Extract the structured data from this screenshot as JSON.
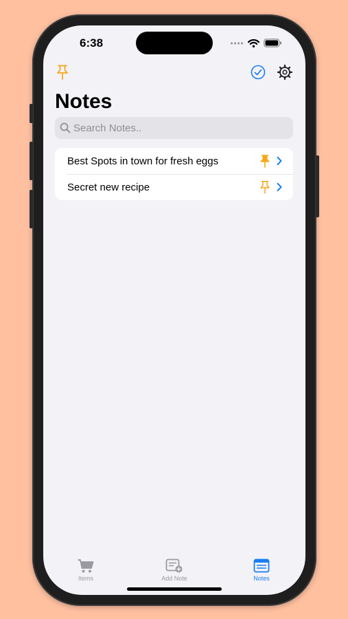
{
  "status_bar": {
    "time": "6:38"
  },
  "toolbar": {
    "pin_filter_icon": "pin-icon",
    "select_icon": "checkmark-circle-icon",
    "settings_icon": "gear-icon"
  },
  "page": {
    "title": "Notes"
  },
  "search": {
    "placeholder": "Search Notes..",
    "value": ""
  },
  "notes": [
    {
      "title": "Best Spots in town for fresh eggs",
      "pinned": true
    },
    {
      "title": "Secret new recipe",
      "pinned": false
    }
  ],
  "tabs": [
    {
      "label": "Items",
      "icon": "cart-icon",
      "selected": false
    },
    {
      "label": "Add Note",
      "icon": "add-note-icon",
      "selected": false
    },
    {
      "label": "Notes",
      "icon": "notes-list-icon",
      "selected": true
    }
  ],
  "colors": {
    "background": "#FFC0A0",
    "accent": "#1A7EF2",
    "pin": "#F6A81C",
    "tab_inactive": "#9A9AA0"
  }
}
